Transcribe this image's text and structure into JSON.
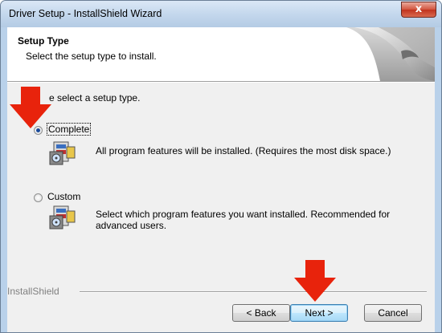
{
  "window": {
    "title": "Driver Setup - InstallShield Wizard",
    "close_glyph": "x"
  },
  "header": {
    "title": "Setup Type",
    "subtitle": "Select the setup type to install."
  },
  "main": {
    "prompt": "e select a setup type.",
    "options": [
      {
        "label": "Complete",
        "selected": true,
        "description": "All program features will be installed. (Requires the most disk space.)"
      },
      {
        "label": "Custom",
        "selected": false,
        "description": "Select which program features you want installed. Recommended for advanced users."
      }
    ]
  },
  "footer": {
    "brand": "InstallShield",
    "back_label": "< Back",
    "next_label": "Next >",
    "cancel_label": "Cancel"
  },
  "colors": {
    "annotation_arrow": "#e8230c",
    "window_frame": "#b9d1ea",
    "dialog_background": "#f0f0f0"
  },
  "icons": [
    "close-icon",
    "setup-type-icon",
    "red-arrow-annotation"
  ]
}
